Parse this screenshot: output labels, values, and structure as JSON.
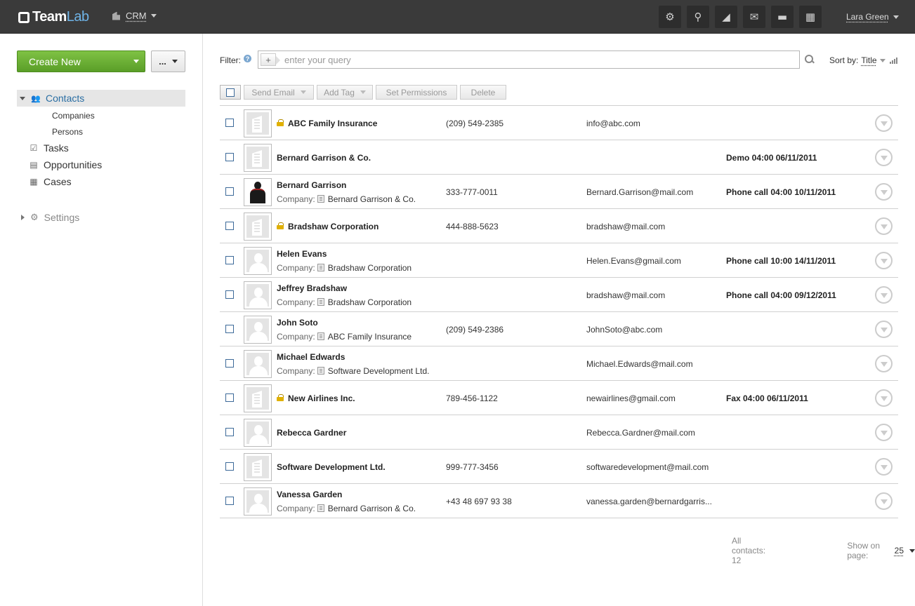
{
  "header": {
    "logo_team": "Team",
    "logo_lab": "Lab",
    "module": "CRM",
    "user": "Lara Green",
    "icons": [
      "gear-icon",
      "search-icon",
      "feed-icon",
      "mail-icon",
      "chat-icon",
      "calendar-icon"
    ]
  },
  "sidebar": {
    "create_label": "Create New",
    "more_label": "...",
    "contacts_label": "Contacts",
    "sub_items": [
      "Companies",
      "Persons"
    ],
    "items": [
      "Tasks",
      "Opportunities",
      "Cases"
    ],
    "settings_label": "Settings"
  },
  "filter": {
    "label": "Filter:",
    "placeholder": "enter your query",
    "sort_label": "Sort by:",
    "sort_value": "Title"
  },
  "actions": {
    "send_email": "Send Email",
    "add_tag": "Add Tag",
    "set_permissions": "Set Permissions",
    "delete": "Delete"
  },
  "contacts": [
    {
      "avatar": "company",
      "locked": true,
      "name": "ABC Family Insurance",
      "company": "",
      "phone": "(209) 549-2385",
      "email": "info@abc.com",
      "event": ""
    },
    {
      "avatar": "company",
      "locked": false,
      "name": "Bernard Garrison & Co.",
      "company": "",
      "phone": "",
      "email": "",
      "event": "Demo 04:00 06/11/2011"
    },
    {
      "avatar": "photo",
      "locked": false,
      "name": "Bernard Garrison",
      "company": "Bernard Garrison & Co.",
      "phone": "333-777-0011",
      "email": "Bernard.Garrison@mail.com",
      "event": "Phone call 04:00 10/11/2011"
    },
    {
      "avatar": "company",
      "locked": true,
      "name": "Bradshaw Corporation",
      "company": "",
      "phone": "444-888-5623",
      "email": "bradshaw@mail.com",
      "event": ""
    },
    {
      "avatar": "person",
      "locked": false,
      "name": "Helen Evans",
      "company": "Bradshaw Corporation",
      "phone": "",
      "email": "Helen.Evans@gmail.com",
      "event": "Phone call 10:00 14/11/2011"
    },
    {
      "avatar": "person",
      "locked": false,
      "name": "Jeffrey Bradshaw",
      "company": "Bradshaw Corporation",
      "phone": "",
      "email": "bradshaw@mail.com",
      "event": "Phone call 04:00 09/12/2011"
    },
    {
      "avatar": "person",
      "locked": false,
      "name": "John Soto",
      "company": "ABC Family Insurance",
      "phone": "(209) 549-2386",
      "email": "JohnSoto@abc.com",
      "event": ""
    },
    {
      "avatar": "person",
      "locked": false,
      "name": "Michael Edwards",
      "company": "Software Development Ltd.",
      "phone": "",
      "email": "Michael.Edwards@mail.com",
      "event": ""
    },
    {
      "avatar": "company",
      "locked": true,
      "name": "New Airlines Inc.",
      "company": "",
      "phone": "789-456-1122",
      "email": "newairlines@gmail.com",
      "event": "Fax 04:00 06/11/2011"
    },
    {
      "avatar": "person",
      "locked": false,
      "name": "Rebecca Gardner",
      "company": "",
      "phone": "",
      "email": "Rebecca.Gardner@mail.com",
      "event": ""
    },
    {
      "avatar": "company",
      "locked": false,
      "name": "Software Development Ltd.",
      "company": "",
      "phone": "999-777-3456",
      "email": "softwaredevelopment@mail.com",
      "event": ""
    },
    {
      "avatar": "person",
      "locked": false,
      "name": "Vanessa Garden",
      "company": "Bernard Garrison & Co.",
      "phone": "+43 48 697 93 38",
      "email": "vanessa.garden@bernardgarris...",
      "event": ""
    }
  ],
  "company_prefix": "Company:",
  "footer": {
    "total": "All contacts: 12",
    "page_label": "Show on page:",
    "page_value": "25"
  }
}
